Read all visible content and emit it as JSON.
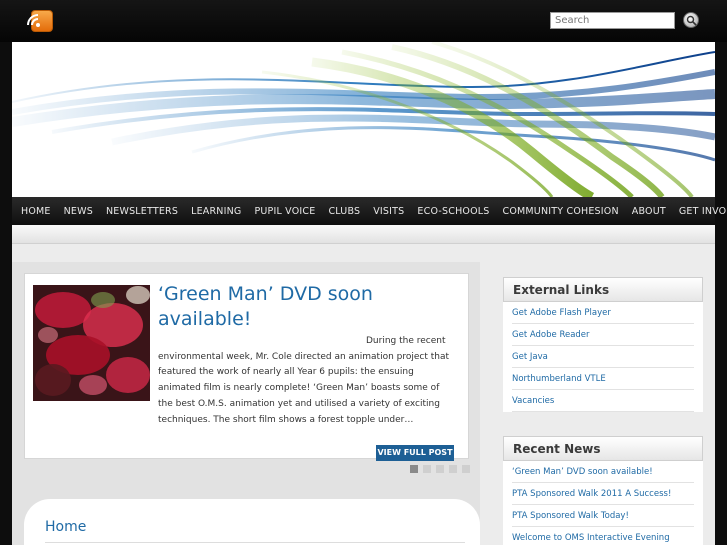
{
  "search": {
    "placeholder": "Search"
  },
  "nav": {
    "items": [
      {
        "label": "HOME"
      },
      {
        "label": "NEWS"
      },
      {
        "label": "NEWSLETTERS"
      },
      {
        "label": "LEARNING"
      },
      {
        "label": "PUPIL VOICE"
      },
      {
        "label": "CLUBS"
      },
      {
        "label": "VISITS"
      },
      {
        "label": "ECO-SCHOOLS"
      },
      {
        "label": "COMMUNITY COHESION"
      },
      {
        "label": "ABOUT"
      },
      {
        "label": "GET INVOLVED"
      }
    ]
  },
  "featured": {
    "title": "‘Green Man’ DVD soon available!",
    "excerpt": "During the recent environmental week, Mr. Cole directed an animation project that featured the work of nearly all Year 6 pupils: the ensuing animated film is nearly complete! ‘Green Man’ boasts some of the best O.M.S. animation yet and utilised a variety of exciting techniques. The short film shows a forest topple under…",
    "button_label": "VIEW FULL POST",
    "slide_count": 5,
    "active_slide": 1
  },
  "home": {
    "title": "Home"
  },
  "sidebar": {
    "external": {
      "heading": "External Links",
      "links": [
        {
          "label": "Get Adobe Flash Player"
        },
        {
          "label": "Get Adobe Reader"
        },
        {
          "label": "Get Java"
        },
        {
          "label": "Northumberland VTLE"
        },
        {
          "label": "Vacancies"
        }
      ]
    },
    "news": {
      "heading": "Recent News",
      "links": [
        {
          "label": "‘Green Man’ DVD soon available!"
        },
        {
          "label": "PTA Sponsored Walk 2011 A Success!"
        },
        {
          "label": "PTA Sponsored Walk Today!"
        },
        {
          "label": "Welcome to OMS Interactive Evening"
        }
      ]
    }
  },
  "icons": {
    "rss": "rss-icon",
    "search": "search-icon"
  },
  "colors": {
    "link": "#1f6aa5",
    "button": "#1d5f95",
    "rss": "#f39a2e"
  }
}
